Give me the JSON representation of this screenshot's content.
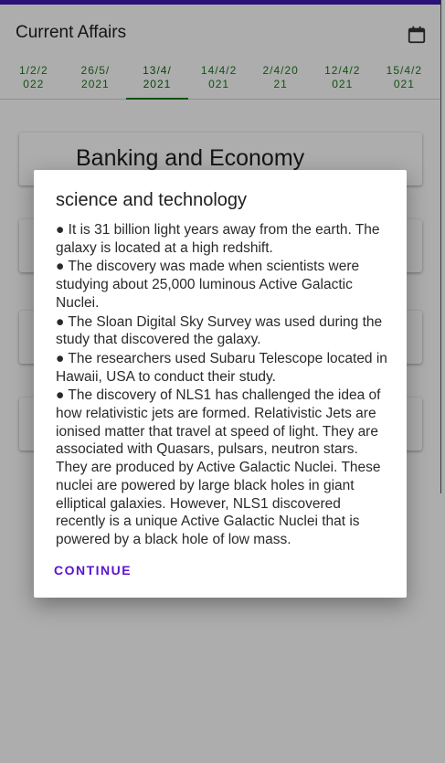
{
  "app": {
    "title": "Current Affairs",
    "calendar_icon": "calendar-icon"
  },
  "tabs": [
    {
      "label": "1/2/2\n022"
    },
    {
      "label": "26/5/\n2021"
    },
    {
      "label": "13/4/\n2021",
      "active": true
    },
    {
      "label": "14/4/2\n021"
    },
    {
      "label": "2/4/20\n21"
    },
    {
      "label": "12/4/2\n021"
    },
    {
      "label": "15/4/2\n021"
    }
  ],
  "cards": [
    {
      "title": "Banking and Economy"
    },
    {
      "title": ""
    },
    {
      "title": ""
    },
    {
      "title": ""
    }
  ],
  "dialog": {
    "title": "science and technology",
    "bullets": [
      "●  It is 31 billion light years away from the earth. The galaxy is located at a high redshift.",
      "●  The discovery was made when scientists were studying about 25,000 luminous Active Galactic Nuclei.",
      "●  The Sloan Digital Sky Survey was used during the study that discovered the galaxy.",
      "●  The researchers used Subaru Telescope located in Hawaii, USA to conduct their study.",
      "●  The discovery of NLS1 has challenged the idea of how relativistic jets are formed. Relativistic Jets are ionised matter that travel at speed of light. They are associated with Quasars, pulsars, neutron stars. They are produced by Active Galactic Nuclei. These nuclei are powered by large black holes in giant elliptical galaxies. However, NLS1 discovered recently is a unique Active Galactic Nuclei that is powered by a black hole of low mass."
    ],
    "button_label": "CONTINUE"
  },
  "colors": {
    "accent": "#3f19b0",
    "tab_text": "#1b7a1b",
    "button": "#5a13d1"
  }
}
